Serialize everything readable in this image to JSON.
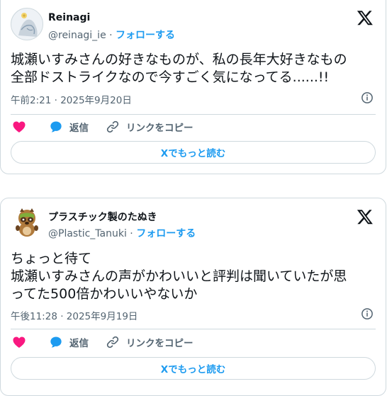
{
  "tweets": [
    {
      "display_name": "Reinagi",
      "handle": "@reinagi_ie",
      "follow_label": "フォローする",
      "text_lines": [
        "城瀬いすみさんの好きなものが、私の長年大好きなもの",
        "全部ドストライクなので今すごく気になってる......!!"
      ],
      "timestamp": "午前2:21 · 2025年9月20日",
      "reply_label": "返信",
      "copy_link_label": "リンクをコピー",
      "read_more_label": "Xでもっと読む"
    },
    {
      "display_name": "プラスチック製のたぬき",
      "handle": "@Plastic_Tanuki",
      "follow_label": "フォローする",
      "text_lines": [
        "ちょっと待て",
        "城瀬いすみさんの声がかわいいと評判は聞いていたが思",
        "ってた500倍かわいいやないか"
      ],
      "timestamp": "午後11:28 · 2025年9月19日",
      "reply_label": "返信",
      "copy_link_label": "リンクをコピー",
      "read_more_label": "Xでもっと読む"
    }
  ],
  "separator": "·",
  "colors": {
    "accent": "#1d9bf0",
    "like": "#f91880",
    "secondary_text": "#536471",
    "border": "#cfd9de"
  },
  "icons": [
    "x-logo-icon",
    "info-icon",
    "heart-icon",
    "reply-bubble-icon",
    "link-icon"
  ]
}
